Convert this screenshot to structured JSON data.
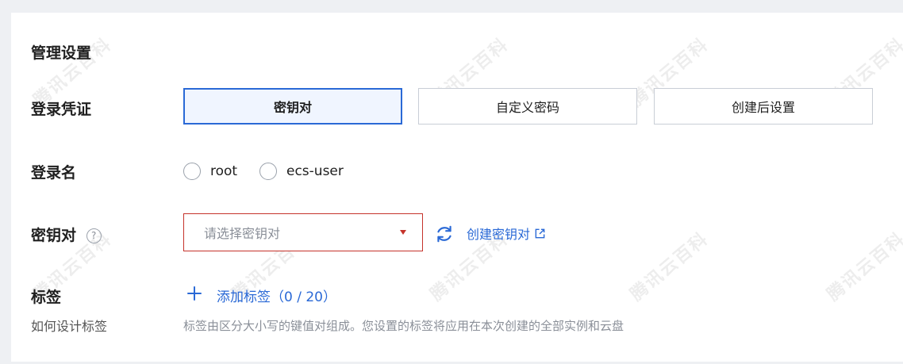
{
  "section_title": "管理设置",
  "login_credential": {
    "label": "登录凭证",
    "options": [
      "密钥对",
      "自定义密码",
      "创建后设置"
    ],
    "selected": "密钥对"
  },
  "login_name": {
    "label": "登录名",
    "options": [
      "root",
      "ecs-user"
    ]
  },
  "key_pair": {
    "label": "密钥对",
    "help_icon": "question-circle-icon",
    "help_glyph": "?",
    "placeholder": "请选择密钥对",
    "create_link": "创建密钥对"
  },
  "tags": {
    "label": "标签",
    "sublabel": "如何设计标签",
    "add_label": "添加标签（0 / 20）",
    "hint": "标签由区分大小写的键值对组成。您设置的标签将应用在本次创建的全部实例和云盘"
  },
  "watermark_text": "腾讯云百科",
  "colors": {
    "accent": "#2a69d6",
    "error": "#c5332b",
    "active_bg": "#f0f5ff"
  }
}
